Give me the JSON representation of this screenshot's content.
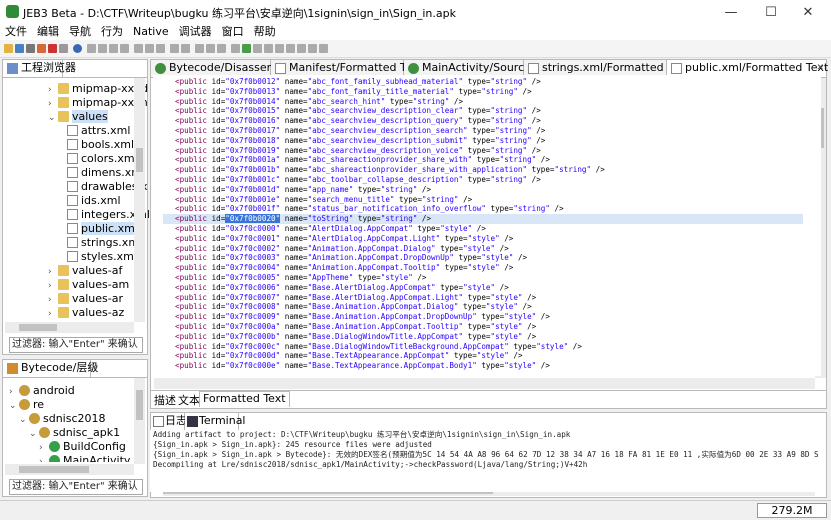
{
  "window": {
    "title": "JEB3 Beta - D:\\CTF\\Writeup\\bugku 练习平台\\安卓逆向\\1signin\\sign_in\\Sign_in.apk",
    "minimize": "—",
    "maximize": "☐",
    "close": "✕"
  },
  "menu": [
    "文件",
    "编辑",
    "导航",
    "行为",
    "Native",
    "调试器",
    "窗口",
    "帮助"
  ],
  "project_panel": {
    "tab": "工程浏览器",
    "items": [
      {
        "label": "mipmap-xxhd",
        "type": "folder"
      },
      {
        "label": "mipmap-xxxh",
        "type": "folder"
      },
      {
        "label": "values",
        "type": "folder"
      },
      {
        "label": "attrs.xml",
        "type": "file"
      },
      {
        "label": "bools.xml",
        "type": "file"
      },
      {
        "label": "colors.xml",
        "type": "file"
      },
      {
        "label": "dimens.xml",
        "type": "file"
      },
      {
        "label": "drawables.x",
        "type": "file"
      },
      {
        "label": "ids.xml",
        "type": "file"
      },
      {
        "label": "integers.xml",
        "type": "file"
      },
      {
        "label": "public.xml",
        "type": "file"
      },
      {
        "label": "strings.xml",
        "type": "file"
      },
      {
        "label": "styles.xml",
        "type": "file"
      },
      {
        "label": "values-af",
        "type": "folder"
      },
      {
        "label": "values-am",
        "type": "folder"
      },
      {
        "label": "values-ar",
        "type": "folder"
      },
      {
        "label": "values-az",
        "type": "folder"
      }
    ],
    "filter": "过滤器: 输入\"Enter\" 来确认"
  },
  "bytecode_panel": {
    "tab": "Bytecode/层级",
    "items": [
      {
        "label": "android",
        "type": "pkg"
      },
      {
        "label": "re",
        "type": "pkg"
      },
      {
        "label": "sdnisc2018",
        "type": "pkg"
      },
      {
        "label": "sdnisc_apk1",
        "type": "pkg"
      },
      {
        "label": "BuildConfig",
        "type": "class"
      },
      {
        "label": "MainActivity",
        "type": "class"
      }
    ],
    "filter": "过滤器: 输入\"Enter\" 来确认"
  },
  "editor_tabs": [
    "Bytecode/Disassembly",
    "Manifest/Formatted Text",
    "MainActivity/Source",
    "strings.xml/Formatted Text",
    "public.xml/Formatted Text"
  ],
  "code_lines": [
    {
      "id": "0x7f0b0012",
      "name": "abc_font_family_subhead_material",
      "type": "string"
    },
    {
      "id": "0x7f0b0013",
      "name": "abc_font_family_title_material",
      "type": "string"
    },
    {
      "id": "0x7f0b0014",
      "name": "abc_search_hint",
      "type": "string"
    },
    {
      "id": "0x7f0b0015",
      "name": "abc_searchview_description_clear",
      "type": "string"
    },
    {
      "id": "0x7f0b0016",
      "name": "abc_searchview_description_query",
      "type": "string"
    },
    {
      "id": "0x7f0b0017",
      "name": "abc_searchview_description_search",
      "type": "string"
    },
    {
      "id": "0x7f0b0018",
      "name": "abc_searchview_description_submit",
      "type": "string"
    },
    {
      "id": "0x7f0b0019",
      "name": "abc_searchview_description_voice",
      "type": "string"
    },
    {
      "id": "0x7f0b001a",
      "name": "abc_shareactionprovider_share_with",
      "type": "string"
    },
    {
      "id": "0x7f0b001b",
      "name": "abc_shareactionprovider_share_with_application",
      "type": "string"
    },
    {
      "id": "0x7f0b001c",
      "name": "abc_toolbar_collapse_description",
      "type": "string"
    },
    {
      "id": "0x7f0b001d",
      "name": "app_name",
      "type": "string"
    },
    {
      "id": "0x7f0b001e",
      "name": "search_menu_title",
      "type": "string"
    },
    {
      "id": "0x7f0b001f",
      "name": "status_bar_notification_info_overflow",
      "type": "string"
    },
    {
      "id": "0x7f0b0020",
      "name": "toString",
      "type": "string"
    },
    {
      "id": "0x7f0c0000",
      "name": "AlertDialog.AppCompat",
      "type": "style"
    },
    {
      "id": "0x7f0c0001",
      "name": "AlertDialog.AppCompat.Light",
      "type": "style"
    },
    {
      "id": "0x7f0c0002",
      "name": "Animation.AppCompat.Dialog",
      "type": "style"
    },
    {
      "id": "0x7f0c0003",
      "name": "Animation.AppCompat.DropDownUp",
      "type": "style"
    },
    {
      "id": "0x7f0c0004",
      "name": "Animation.AppCompat.Tooltip",
      "type": "style"
    },
    {
      "id": "0x7f0c0005",
      "name": "AppTheme",
      "type": "style"
    },
    {
      "id": "0x7f0c0006",
      "name": "Base.AlertDialog.AppCompat",
      "type": "style"
    },
    {
      "id": "0x7f0c0007",
      "name": "Base.AlertDialog.AppCompat.Light",
      "type": "style"
    },
    {
      "id": "0x7f0c0008",
      "name": "Base.Animation.AppCompat.Dialog",
      "type": "style"
    },
    {
      "id": "0x7f0c0009",
      "name": "Base.Animation.AppCompat.DropDownUp",
      "type": "style"
    },
    {
      "id": "0x7f0c000a",
      "name": "Base.Animation.AppCompat.Tooltip",
      "type": "style"
    },
    {
      "id": "0x7f0c000b",
      "name": "Base.DialogWindowTitle.AppCompat",
      "type": "style"
    },
    {
      "id": "0x7f0c000c",
      "name": "Base.DialogWindowTitleBackground.AppCompat",
      "type": "style"
    },
    {
      "id": "0x7f0c000d",
      "name": "Base.TextAppearance.AppCompat",
      "type": "style"
    },
    {
      "id": "0x7f0c000e",
      "name": "Base.TextAppearance.AppCompat.Body1",
      "type": "style"
    }
  ],
  "code_tokens": {
    "open": "<public",
    "id_attr": "id=",
    "name_attr": "name=",
    "type_attr": "type=",
    "close": "/>"
  },
  "view_tabs": [
    "描述",
    "文本",
    "Formatted Text"
  ],
  "log_tabs": [
    "日志",
    "Terminal"
  ],
  "log_lines": [
    "Adding artifact to project: D:\\CTF\\Writeup\\bugku 练习平台\\安卓逆向\\1signin\\sign_in\\Sign_in.apk",
    "{Sign_in.apk > Sign_in.apk}: 245 resource files were adjusted",
    "{Sign_in.apk > Sign_in.apk > Bytecode}: 无效的DEX签名(预期值为5C 14 54 4A A8 96 64 62 7D 12 38 34 A7 16 18 FA 81 1E E0 11 ,实际值为6D 00 2E 33 A9 8D S",
    "Decompiling at Lre/sdnisc2018/sdnisc_apk1/MainActivity;->checkPassword(Ljava/lang/String;)V+42h"
  ],
  "status": {
    "memory": "279.2M"
  },
  "colors": {
    "keyword": "#7f0055",
    "string": "#2a00ff",
    "highlight": "#d9e6f8",
    "selection": "#3875d7"
  }
}
